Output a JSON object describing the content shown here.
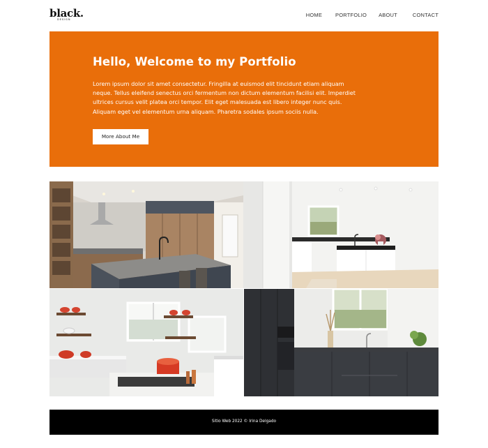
{
  "header": {
    "logo": {
      "main": "black.",
      "sub": "DESIGN"
    },
    "nav": [
      {
        "label": "HOME"
      },
      {
        "label": "PORTFOLIO"
      },
      {
        "label": "ABOUT"
      },
      {
        "label": "CONTACT"
      }
    ]
  },
  "hero": {
    "title": "Hello, Welcome to my Portfolio",
    "text": "Lorem ipsum dolor sit amet consectetur. Fringilla at euismod elit tincidunt etiam aliquam neque. Tellus eleifend senectus orci fermentum non dictum elementum facilisi elit. Imperdiet ultrices cursus velit platea orci tempor. Elit eget malesuada est libero integer nunc quis. Aliquam eget vel elementum urna aliquam. Pharetra sodales ipsum sociis nulla.",
    "button_label": "More About Me",
    "background_color": "#e96e0a"
  },
  "gallery": {
    "images": [
      {
        "subject": "kitchen-island-wood-cabinets"
      },
      {
        "subject": "white-kitchen-black-countertop"
      },
      {
        "subject": "white-kitchen-open-shelves-red-pots"
      },
      {
        "subject": "dark-grey-kitchen-window"
      }
    ]
  },
  "footer": {
    "text": "Sitio Web 2022 © Irina Delgado",
    "background_color": "#000000"
  }
}
